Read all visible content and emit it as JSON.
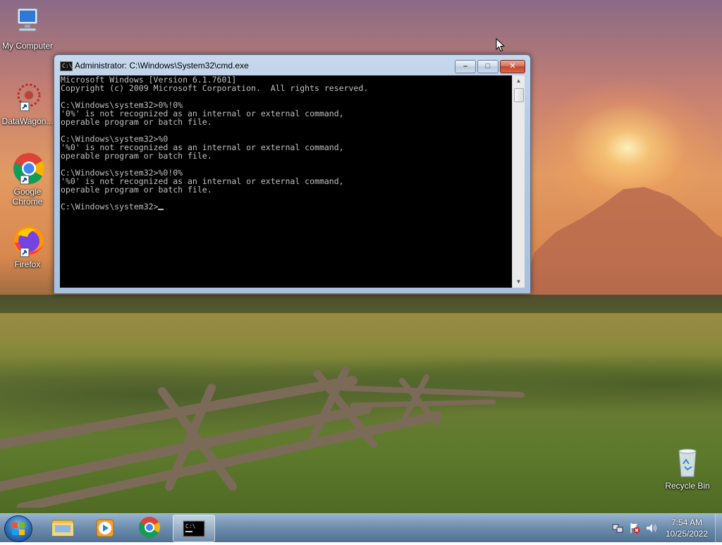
{
  "desktop": {
    "icons": [
      {
        "label": "My Computer",
        "icon": "computer-icon"
      },
      {
        "label": "DataWagon...",
        "icon": "datawagon-icon"
      },
      {
        "label": "Google Chrome",
        "icon": "chrome-icon"
      },
      {
        "label": "Firefox",
        "icon": "firefox-icon"
      },
      {
        "label": "Recycle Bin",
        "icon": "recycle-bin-icon"
      }
    ]
  },
  "cmd_window": {
    "title": "Administrator: C:\\Windows\\System32\\cmd.exe",
    "icon_text": "C:\\",
    "buttons": {
      "minimize": "–",
      "maximize": "□",
      "close": "✕"
    },
    "lines": [
      "Microsoft Windows [Version 6.1.7601]",
      "Copyright (c) 2009 Microsoft Corporation.  All rights reserved.",
      "",
      "C:\\Windows\\system32>0%!0%",
      "'0%' is not recognized as an internal or external command,",
      "operable program or batch file.",
      "",
      "C:\\Windows\\system32>%0",
      "'%0' is not recognized as an internal or external command,",
      "operable program or batch file.",
      "",
      "C:\\Windows\\system32>%0!0%",
      "'%0' is not recognized as an internal or external command,",
      "operable program or batch file.",
      "",
      "C:\\Windows\\system32>"
    ]
  },
  "taskbar": {
    "pinned": [
      {
        "name": "windows-explorer",
        "icon": "folder-icon"
      },
      {
        "name": "media-player",
        "icon": "media-player-icon"
      },
      {
        "name": "google-chrome",
        "icon": "chrome-icon"
      },
      {
        "name": "command-prompt",
        "icon": "cmd-icon",
        "active": true
      }
    ],
    "clock": {
      "time": "7:54 AM",
      "date": "10/25/2022"
    }
  },
  "colors": {
    "console_bg": "#000000",
    "console_text": "#c0c0c0",
    "taskbar": "#5f82a5"
  }
}
